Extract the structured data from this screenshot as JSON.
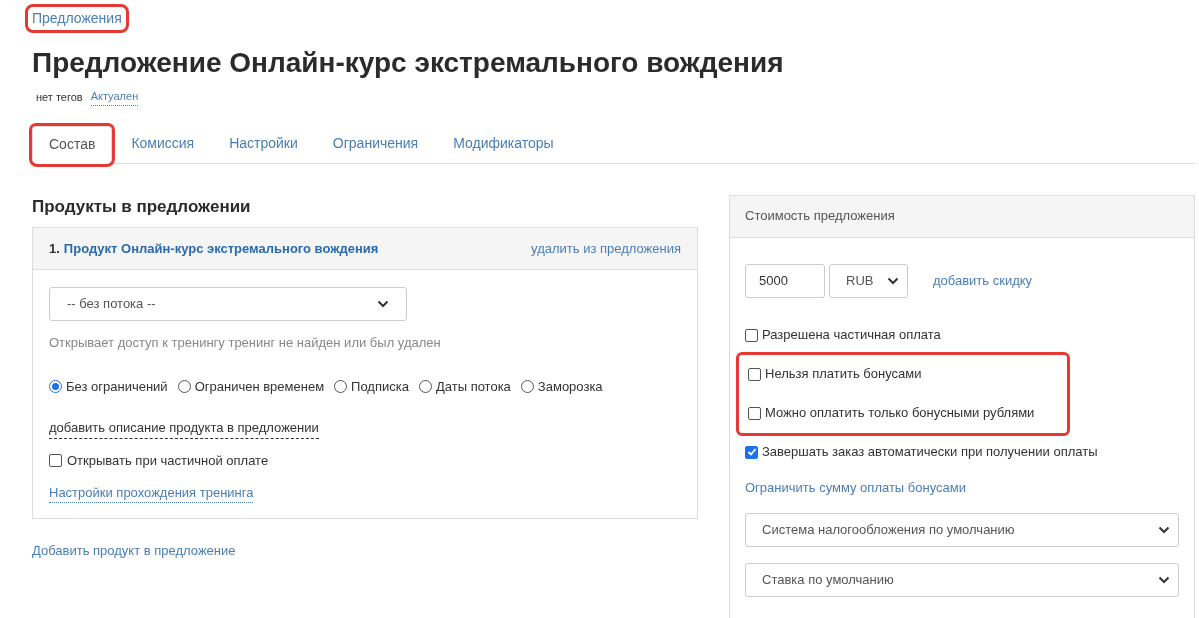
{
  "breadcrumb": {
    "label": "Предложения",
    "highlighted": true
  },
  "title": "Предложение Онлайн-курс экстремального вождения",
  "tags": {
    "label": "нет тегов",
    "status": "Актуален"
  },
  "tabs": [
    {
      "label": "Состав",
      "selected": true,
      "highlighted": true
    },
    {
      "label": "Комиссия",
      "selected": false,
      "highlighted": false
    },
    {
      "label": "Настройки",
      "selected": false,
      "highlighted": false
    },
    {
      "label": "Ограничения",
      "selected": false,
      "highlighted": false
    },
    {
      "label": "Модификаторы",
      "selected": false,
      "highlighted": false
    }
  ],
  "products": {
    "heading": "Продукты в предложении",
    "items": [
      {
        "number": "1.",
        "name": "Продукт Онлайн-курс экстремального вождения",
        "remove_link": "удалить из предложения",
        "stream_select": "-- без потока --",
        "access_note": "Открывает доступ к тренингу тренинг не найден или был удален",
        "access_options": [
          {
            "label": "Без ограничений",
            "selected": true
          },
          {
            "label": "Ограничен временем",
            "selected": false
          },
          {
            "label": "Подписка",
            "selected": false
          },
          {
            "label": "Даты потока",
            "selected": false
          },
          {
            "label": "Заморозка",
            "selected": false
          }
        ],
        "description_link": "добавить описание продукта в предложении",
        "partial_open": {
          "label": "Открывать при частичной оплате",
          "checked": false
        },
        "settings_link": "Настройки прохождения тренинга"
      }
    ],
    "add_link": "Добавить продукт в предложение"
  },
  "pricing": {
    "header": "Стоимость предложения",
    "price": "5000",
    "currency": "RUB",
    "discount_link": "добавить скидку",
    "option_groups": [
      {
        "highlighted": false,
        "options": [
          {
            "label": "Разрешена частичная оплата",
            "checked": false
          }
        ]
      },
      {
        "highlighted": true,
        "options": [
          {
            "label": "Нельзя платить бонусами",
            "checked": false
          },
          {
            "label": "Можно оплатить только бонусными рублями",
            "checked": false
          }
        ]
      },
      {
        "highlighted": false,
        "options": [
          {
            "label": "Завершать заказ автоматически при получении оплаты",
            "checked": true
          }
        ]
      }
    ],
    "bonus_limit_link": "Ограничить сумму оплаты бонусами",
    "tax_select": "Система налогообложения по умолчанию",
    "rate_select": "Ставка по умолчанию"
  }
}
